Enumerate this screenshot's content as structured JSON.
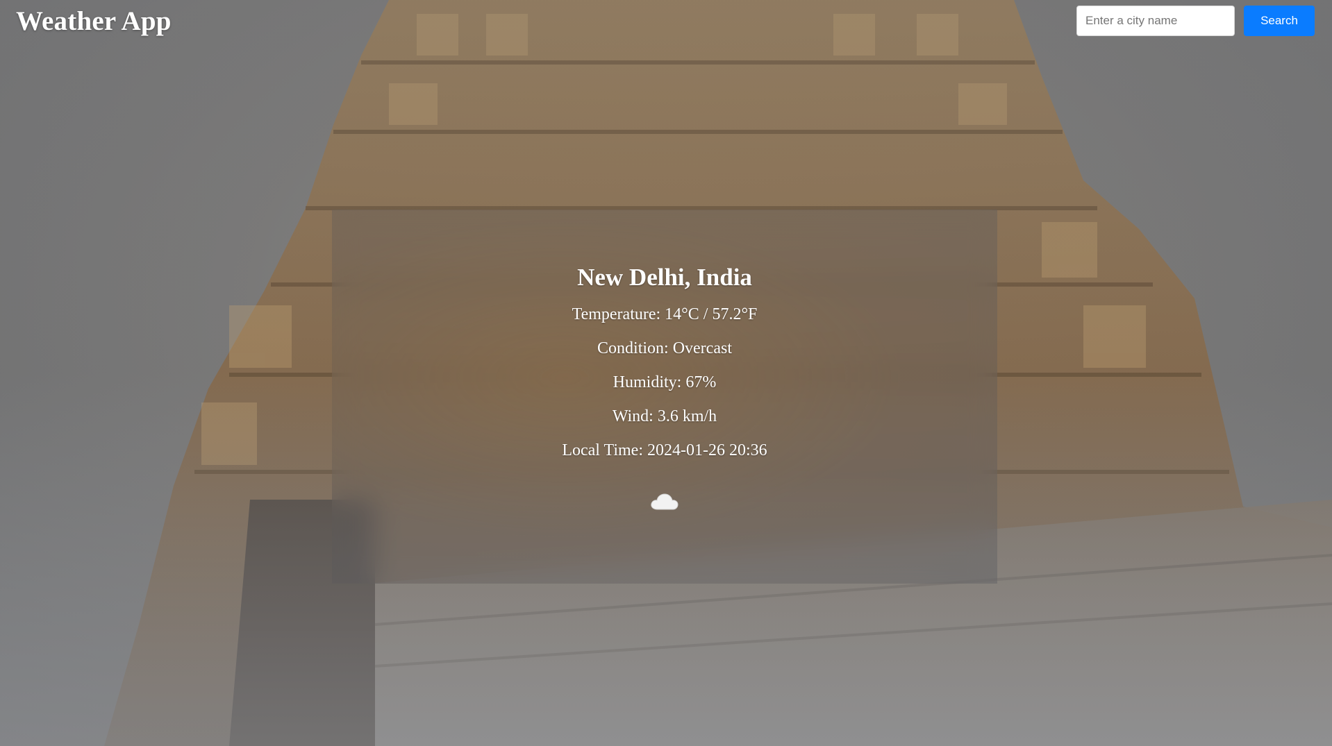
{
  "app": {
    "title": "Weather App"
  },
  "search": {
    "placeholder": "Enter a city name",
    "value": "",
    "button_label": "Search"
  },
  "weather": {
    "location": "New Delhi, India",
    "temperature": "Temperature: 14°C / 57.2°F",
    "condition": "Condition: Overcast",
    "humidity": "Humidity: 67%",
    "wind": "Wind: 3.6 km/h",
    "local_time": "Local Time: 2024-01-26 20:36",
    "icon": "cloud-icon"
  },
  "colors": {
    "accent": "#0a7cff",
    "text": "#ffffff"
  }
}
